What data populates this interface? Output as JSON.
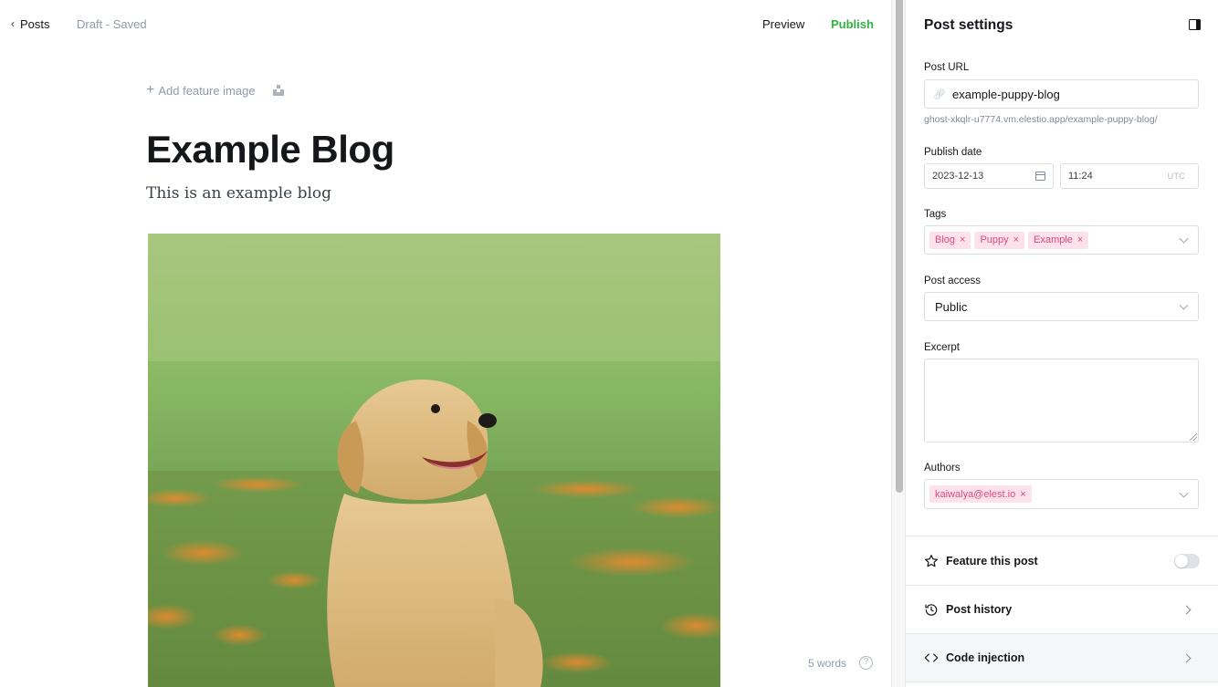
{
  "topbar": {
    "back_label": "Posts",
    "status": "Draft - Saved",
    "preview_label": "Preview",
    "publish_label": "Publish"
  },
  "editor": {
    "add_feature_image_label": "Add feature image",
    "title": "Example Blog",
    "subtitle": "This is an example blog",
    "image_alt": "Golden retriever puppy sitting in a field of orange flowers",
    "word_count": "5 words",
    "help_glyph": "?"
  },
  "colors": {
    "publish": "#2fb344",
    "tag_bg": "#fde2ec",
    "tag_text": "#e0487e"
  },
  "settings": {
    "title": "Post settings",
    "post_url": {
      "label": "Post URL",
      "value": "example-puppy-blog",
      "hint": "ghost-xkqlr-u7774.vm.elestio.app/example-puppy-blog/"
    },
    "publish_date": {
      "label": "Publish date",
      "date": "2023-12-13",
      "time": "11:24",
      "timezone": "UTC"
    },
    "tags": {
      "label": "Tags",
      "items": [
        {
          "label": "Blog"
        },
        {
          "label": "Puppy"
        },
        {
          "label": "Example"
        }
      ],
      "remove_glyph": "×"
    },
    "post_access": {
      "label": "Post access",
      "value": "Public"
    },
    "excerpt": {
      "label": "Excerpt",
      "value": ""
    },
    "authors": {
      "label": "Authors",
      "items": [
        {
          "label": "kaiwalya@elest.io"
        }
      ]
    },
    "rows": {
      "feature": {
        "label": "Feature this post",
        "enabled": false
      },
      "history": {
        "label": "Post history"
      },
      "code_injection": {
        "label": "Code injection"
      }
    }
  }
}
